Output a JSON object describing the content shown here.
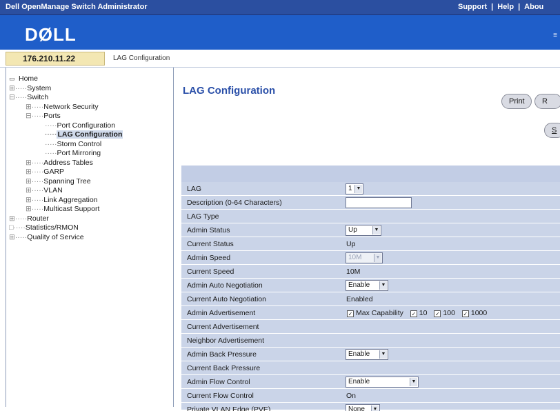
{
  "topbar": {
    "app_title": "Dell OpenManage Switch Administrator",
    "support": "Support",
    "help": "Help",
    "about": "Abou"
  },
  "banner": {
    "logo": "DØLL",
    "eq_glyph": "≡"
  },
  "addr": {
    "ip": "176.210.11.22",
    "breadcrumb": "LAG Configuration"
  },
  "tree": [
    {
      "label": "Home"
    },
    {
      "label": "System"
    },
    {
      "label": "Switch"
    },
    {
      "label": "Network Security"
    },
    {
      "label": "Ports"
    },
    {
      "label": "Port Configuration"
    },
    {
      "label": "LAG Configuration"
    },
    {
      "label": "Storm Control"
    },
    {
      "label": "Port Mirroring"
    },
    {
      "label": "Address Tables"
    },
    {
      "label": "GARP"
    },
    {
      "label": "Spanning Tree"
    },
    {
      "label": "VLAN"
    },
    {
      "label": "Link Aggregation"
    },
    {
      "label": "Multicast Support"
    },
    {
      "label": "Router"
    },
    {
      "label": "Statistics/RMON"
    },
    {
      "label": "Quality of Service"
    }
  ],
  "page": {
    "title": "LAG Configuration",
    "print_label": "Print",
    "r_label": "R",
    "s_label": "S"
  },
  "form": {
    "lag_label": "LAG",
    "lag_value": "1",
    "desc_label": "Description (0-64 Characters)",
    "desc_value": "",
    "lag_type_label": "LAG Type",
    "admin_status_label": "Admin Status",
    "admin_status_value": "Up",
    "current_status_label": "Current Status",
    "current_status_value": "Up",
    "admin_speed_label": "Admin Speed",
    "admin_speed_value": "10M",
    "current_speed_label": "Current Speed",
    "current_speed_value": "10M",
    "admin_autoneg_label": "Admin Auto Negotiation",
    "admin_autoneg_value": "Enable",
    "current_autoneg_label": "Current Auto Negotiation",
    "current_autoneg_value": "Enabled",
    "admin_adv_label": "Admin Advertisement",
    "adv_options": [
      "Max Capability",
      "10",
      "100",
      "1000"
    ],
    "current_adv_label": "Current Advertisement",
    "neighbor_adv_label": "Neighbor Advertisement",
    "admin_bp_label": "Admin Back Pressure",
    "admin_bp_value": "Enable",
    "current_bp_label": "Current Back Pressure",
    "admin_fc_label": "Admin Flow Control",
    "admin_fc_value": "Enable",
    "current_fc_label": "Current Flow Control",
    "current_fc_value": "On",
    "pvlan_label": "Private VLAN Edge (PVE)",
    "pvlan_value": "None"
  }
}
